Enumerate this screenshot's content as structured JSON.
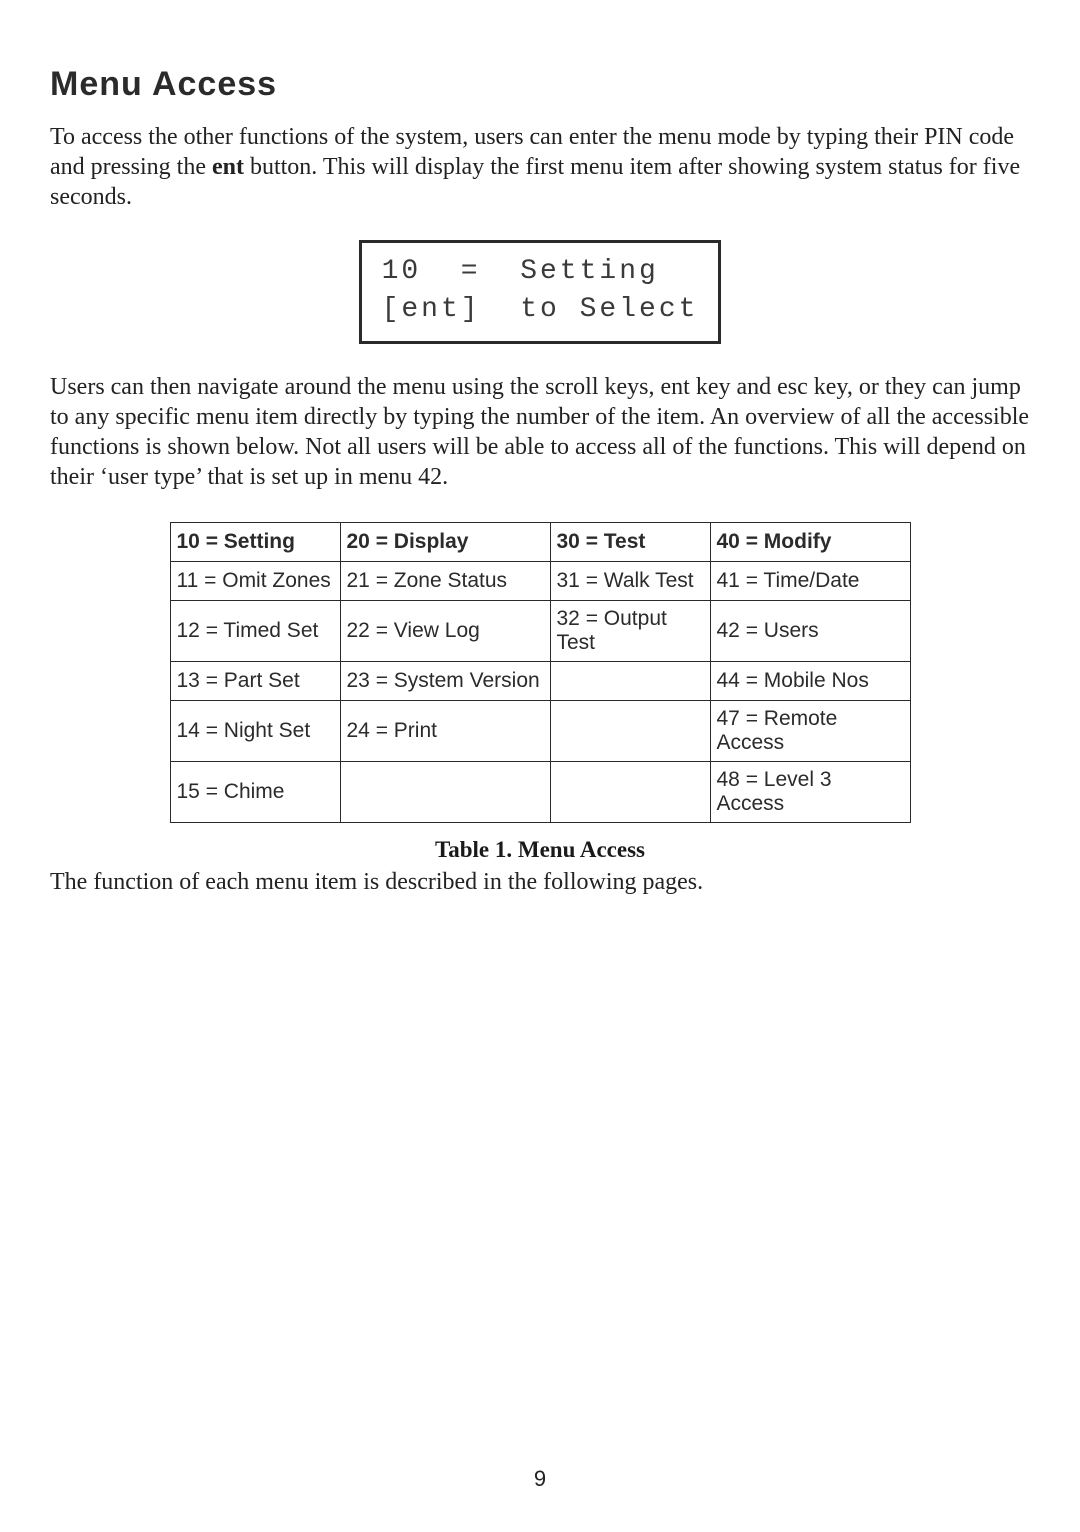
{
  "title": "Menu Access",
  "intro_html": "To access the other functions of the system, users can enter the menu mode by typing their PIN code and pressing the <span class=\"bold\">ent</span> button. This will display the first menu item after showing system status for five seconds.",
  "lcd": {
    "line1": "10  =  Setting",
    "line2": "[ent]  to Select"
  },
  "mid_paragraph": "Users can then navigate around the menu using the scroll keys, ent key and esc key, or they can jump to any specific menu item directly by typing the number of the item. An overview of all the accessible functions is shown below. Not all users will be able to access all of the functions. This will depend on their ‘user type’ that is set up in menu 42.",
  "table": {
    "headers": [
      "10 = Setting",
      "20 = Display",
      "30 = Test",
      "40 = Modify"
    ],
    "rows": [
      [
        "11 = Omit Zones",
        "21 = Zone Status",
        "31 = Walk Test",
        "41 = Time/Date"
      ],
      [
        "12 = Timed Set",
        "22 = View Log",
        "32 = Output Test",
        "42 = Users"
      ],
      [
        "13 = Part Set",
        "23 = System Version",
        "",
        "44 = Mobile Nos"
      ],
      [
        "14 = Night Set",
        "24 = Print",
        "",
        "47 = Remote Access"
      ],
      [
        "15 = Chime",
        "",
        "",
        "48 = Level 3 Access"
      ]
    ],
    "col_widths": [
      "170px",
      "210px",
      "160px",
      "200px"
    ]
  },
  "table_caption": "Table 1. Menu Access",
  "closing_paragraph": "The function of each menu item is described in the following pages.",
  "page_number": "9"
}
